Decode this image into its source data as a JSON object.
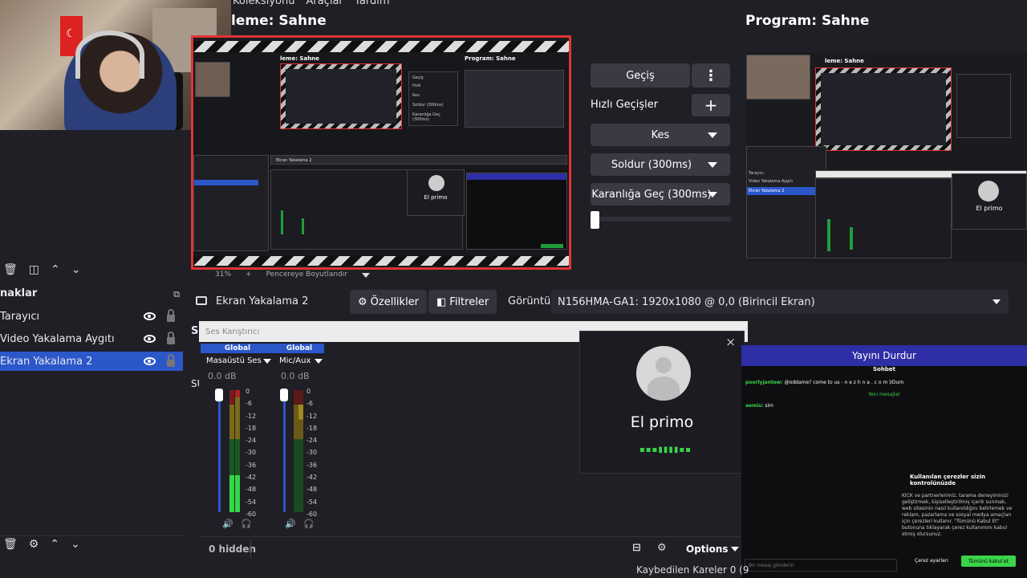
{
  "menu": {
    "items": [
      "Koleksiyonu",
      "Araçlar",
      "Yardım"
    ]
  },
  "preview": {
    "title": "leme: Sahne",
    "inner_left_title": "leme: Sahne",
    "inner_right_title": "Program: Sahne",
    "inner_buttons": [
      "Geçiş",
      "Hızlı",
      "Kes",
      "Soldur (300ms)",
      "Karanlığa Geç (300ms)"
    ],
    "inner_source_label": "Ekran Yakalama 2",
    "inner_call_name": "El primo"
  },
  "program": {
    "title": "Program: Sahne",
    "inner_title_left": "leme: Sahne",
    "inner_call_name": "El primo",
    "inner_sources": [
      "Tarayıcı",
      "Video Yakalama Aygıtı",
      "Ekran Yakalama 2"
    ]
  },
  "transitions": {
    "transition_button": "Geçiş",
    "quick_label": "Hızlı Geçişler",
    "cut": "Kes",
    "fade": "Soldur (300ms)",
    "fade_black": "Karanlığa Geç (300ms)"
  },
  "zoom": {
    "percent": "31%",
    "plus": "+",
    "fit_label": "Pencereye Boyutlandır"
  },
  "sources": {
    "header": "naklar",
    "items": [
      {
        "label": "Tarayıcı",
        "selected": false
      },
      {
        "label": "Video Yakalama Aygıtı",
        "selected": false
      },
      {
        "label": "Ekran Yakalama 2",
        "selected": true
      }
    ]
  },
  "properties_bar": {
    "source_name": "Ekran Yakalama 2",
    "properties": "Özellikler",
    "filters": "Filtreler",
    "display_label": "Görüntü",
    "display_value": "N156HMA-GA1: 1920x1080 @ 0,0 (Birincil Ekran)"
  },
  "side_letter": "S",
  "side_letter_2": "SÜ",
  "mixer": {
    "title": "Ses Karıştırıcı",
    "channels": [
      {
        "tag": "Global",
        "name": "Masaüstü Ses",
        "db": "0.0 dB",
        "level": 0.3
      },
      {
        "tag": "Global",
        "name": "Mic/Aux",
        "db": "0.0 dB",
        "level": 0.0
      }
    ],
    "scale": [
      "0",
      "-6",
      "-12",
      "-18",
      "-24",
      "-30",
      "-36",
      "-42",
      "-48",
      "-54",
      "-60"
    ],
    "hidden": "0 hidden",
    "options": "Options"
  },
  "call": {
    "name": "El primo"
  },
  "chat": {
    "stop_stream": "Yayını Durdur",
    "header": "Sohbet",
    "msg1_user": "poorlyjantew:",
    "msg1_text": "@oddame? come to us - n e z h n a . c o m l/Dum",
    "new_messages": "Yeni mesajlar",
    "msg2_user": "aemis:",
    "msg2_text": "sim",
    "cookie_title": "Kullanılan çerezler sizin kontrolünüzde",
    "cookie_body": "KICK ve partnerlerimiz, tarama deneyiminizi geliştirmek, kişiselleştirilmiş içerik sunmak, web sitesinin nasıl kullanıldığını belirlemek ve reklam, pazarlama ve sosyal medya amaçları için çerezleri kullanır. \"Tümünü Kabul Et\" butonuna tıklayarak çerez kullanımını kabul etmiş olursunuz.",
    "cookie_settings": "Çerez ayarları",
    "cookie_accept": "Tümünü kabul et",
    "input_placeholder": "Bir mesaj gönderin"
  },
  "status": {
    "dropped_frames": "Kaybedilen Kareler 0 (9"
  },
  "colors": {
    "accent": "#2b57c9",
    "record_red": "#e23333",
    "kick_green": "#3bd34a",
    "panel_bg": "#1f1f25"
  }
}
